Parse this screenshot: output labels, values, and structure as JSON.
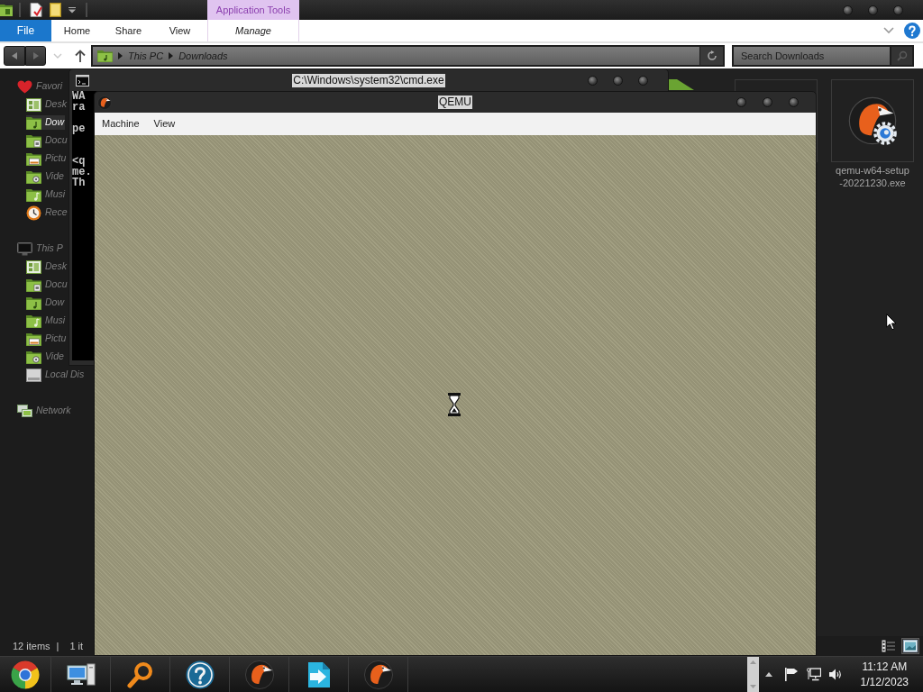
{
  "explorer": {
    "context_tab": {
      "label": "Application Tools"
    },
    "ribbon_tabs": [
      {
        "label": "File",
        "kind": "file"
      },
      {
        "label": "Home",
        "kind": "tab"
      },
      {
        "label": "Share",
        "kind": "tab"
      },
      {
        "label": "View",
        "kind": "tab"
      },
      {
        "label": "Manage",
        "kind": "context"
      }
    ],
    "address": {
      "path": [
        "This PC",
        "Downloads"
      ]
    },
    "search": {
      "placeholder": "Search Downloads"
    },
    "sidebar": [
      {
        "label": "Favori",
        "kind": "favorites",
        "selected": false,
        "children": [
          {
            "label": "Desk",
            "kind": "desktop",
            "selected": false
          },
          {
            "label": "Dow",
            "kind": "downloads",
            "selected": true
          },
          {
            "label": "Docu",
            "kind": "documents",
            "selected": false
          },
          {
            "label": "Pictu",
            "kind": "pictures",
            "selected": false
          },
          {
            "label": "Vide",
            "kind": "videos",
            "selected": false
          },
          {
            "label": "Musi",
            "kind": "music",
            "selected": false
          },
          {
            "label": "Rece",
            "kind": "recent",
            "selected": false
          }
        ]
      },
      {
        "label": "This P",
        "kind": "computer",
        "selected": false,
        "children": [
          {
            "label": "Desk",
            "kind": "desktop",
            "selected": false
          },
          {
            "label": "Docu",
            "kind": "documents",
            "selected": false
          },
          {
            "label": "Dow",
            "kind": "downloads",
            "selected": false
          },
          {
            "label": "Musi",
            "kind": "music",
            "selected": false
          },
          {
            "label": "Pictu",
            "kind": "pictures",
            "selected": false
          },
          {
            "label": "Vide",
            "kind": "videos",
            "selected": false
          },
          {
            "label": "Local Dis",
            "kind": "drive",
            "selected": false
          }
        ]
      },
      {
        "label": "Network",
        "kind": "network",
        "selected": false
      }
    ],
    "files": [
      {
        "name": "qemu-w64-setup-20221230.exe"
      }
    ],
    "status": {
      "count": "12 items",
      "separator": "|",
      "selection": "1 it"
    },
    "view_buttons": [
      {
        "kind": "details",
        "selected": false
      },
      {
        "kind": "large_icons",
        "selected": true
      }
    ]
  },
  "cmd": {
    "title": "C:\\Windows\\system32\\cmd.exe",
    "blocks": [
      [
        "WA",
        "ra"
      ],
      [
        "pe"
      ],
      [
        "<q",
        "me.",
        "Th"
      ]
    ]
  },
  "qemu": {
    "title": "QEMU",
    "menu": [
      "Machine",
      "View"
    ]
  },
  "taskbar": {
    "apps": [
      {
        "kind": "browser"
      },
      {
        "kind": "computer"
      },
      {
        "kind": "search"
      },
      {
        "kind": "help"
      },
      {
        "kind": "qemu"
      },
      {
        "kind": "transfer"
      },
      {
        "kind": "qemu"
      }
    ],
    "time": "11:12 AM",
    "date": "1/12/2023"
  }
}
